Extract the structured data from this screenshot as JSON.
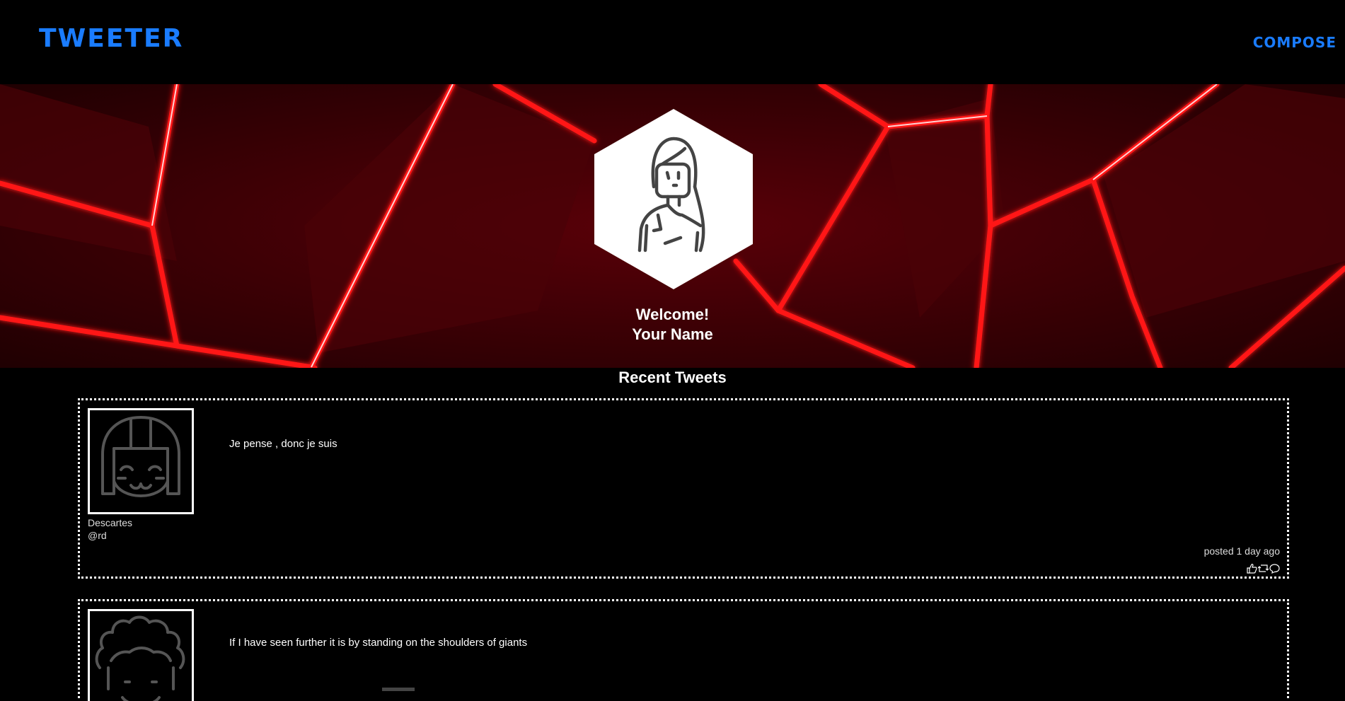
{
  "nav": {
    "brand": "TWEETER",
    "compose_label": "COMPOSE"
  },
  "hero": {
    "avatar_icon": "woman-avatar-icon",
    "welcome": "Welcome!",
    "name": "Your Name"
  },
  "feed": {
    "title": "Recent Tweets",
    "tweets": [
      {
        "avatar_icon": "girl-face-avatar-icon",
        "content": "Je pense , donc je suis",
        "author": "Descartes",
        "handle": "@rd",
        "posted": "posted 1 day ago"
      },
      {
        "avatar_icon": "curly-hair-avatar-icon",
        "content": "If I have seen further it is by standing on the shoulders of giants"
      }
    ]
  },
  "colors": {
    "accent": "#1a7cff",
    "background": "#000000",
    "hero_red": "#ff1a1a"
  }
}
